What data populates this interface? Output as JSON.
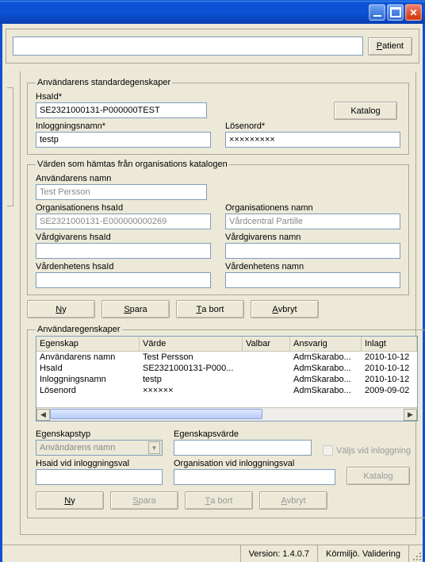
{
  "toolbar": {
    "patient_label": "Patient"
  },
  "accel": {
    "patient": "P",
    "ny": "N",
    "spara": "S",
    "tabort": "T",
    "avbryt": "A"
  },
  "group1": {
    "legend": "Användarens standardegenskaper",
    "hsaid_label": "HsaId*",
    "hsaid_value": "SE2321000131-P000000TEST",
    "katalog_label": "Katalog",
    "inlogg_label": "Inloggningsnamn*",
    "inlogg_value": "testp",
    "losenord_label": "Lösenord*",
    "losenord_value": "×××××××××"
  },
  "group2": {
    "legend": "Värden som hämtas från organisations katalogen",
    "anv_namn_label": "Användarens namn",
    "anv_namn_value": "Test Persson",
    "org_hsaid_label": "Organisationens hsaId",
    "org_hsaid_value": "SE2321000131-E000000000269",
    "org_namn_label": "Organisationens namn",
    "org_namn_value": "Vårdcentral Partille",
    "vardgiv_hsaid_label": "Vårdgivarens hsaId",
    "vardgiv_hsaid_value": "",
    "vardgiv_namn_label": "Vårdgivarens namn",
    "vardgiv_namn_value": "",
    "vardenhet_hsaid_label": "Vårdenhetens hsaId",
    "vardenhet_hsaid_value": "",
    "vardenhet_namn_label": "Vårdenhetens namn",
    "vardenhet_namn_value": ""
  },
  "buttons": {
    "ny": "y",
    "spara": "para",
    "tabort": "a bort",
    "avbryt": "vbryt"
  },
  "group3": {
    "legend": "Användaregenskaper",
    "columns": [
      "Egenskap",
      "Värde",
      "Valbar",
      "Ansvarig",
      "Inlagt"
    ],
    "rows": [
      {
        "egenskap": "Användarens namn",
        "varde": "Test Persson",
        "valbar": "",
        "ansvarig": "AdmSkarabo...",
        "inlagt": "2010-10-12"
      },
      {
        "egenskap": "HsaId",
        "varde": "SE2321000131-P000...",
        "valbar": "",
        "ansvarig": "AdmSkarabo...",
        "inlagt": "2010-10-12"
      },
      {
        "egenskap": "Inloggningsnamn",
        "varde": "testp",
        "valbar": "",
        "ansvarig": "AdmSkarabo...",
        "inlagt": "2010-10-12"
      },
      {
        "egenskap": "Lösenord",
        "varde": "××××××",
        "valbar": "",
        "ansvarig": "AdmSkarabo...",
        "inlagt": "2009-09-02"
      }
    ],
    "form": {
      "egenskapstyp_label": "Egenskapstyp",
      "egenskapstyp_value": "Användarens namn",
      "egenskapsvarde_label": "Egenskapsvärde",
      "valjs_label": "Väljs vid inloggning",
      "hsaid_label": "Hsaid vid inloggningsval",
      "org_label": "Organisation vid inloggningsval",
      "katalog_label": "Katalog"
    }
  },
  "status": {
    "version": "Version: 1.4.0.7",
    "env": "Körmiljö. Validering"
  }
}
